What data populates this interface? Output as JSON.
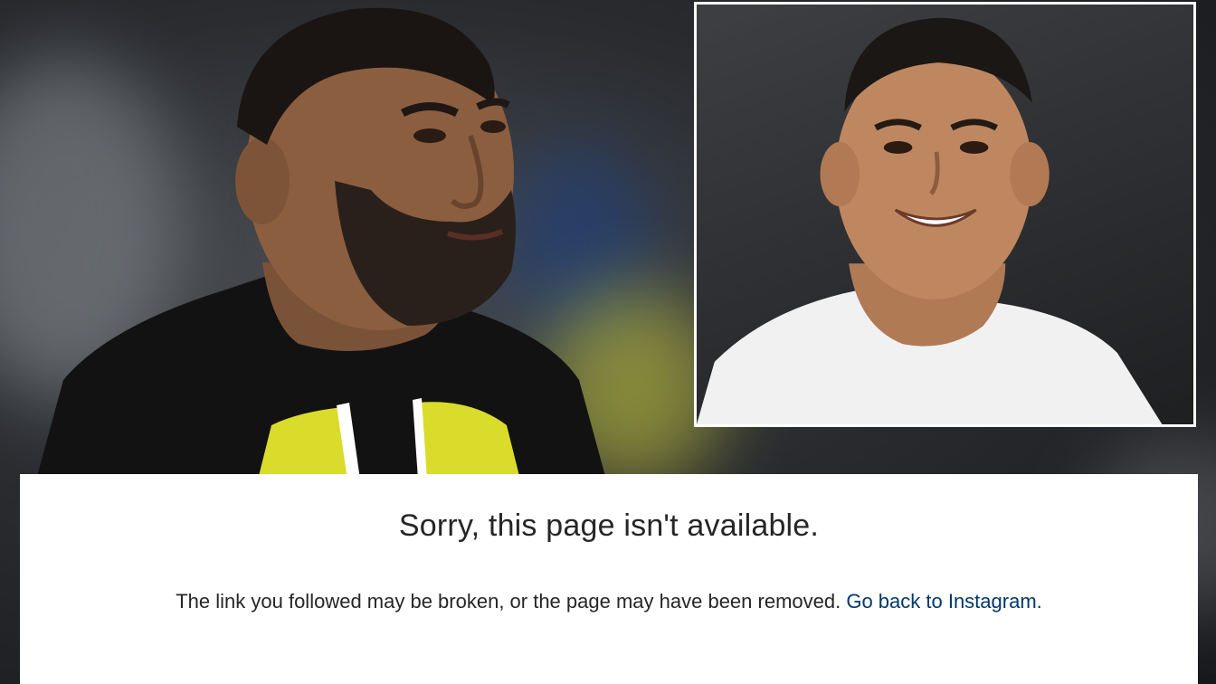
{
  "error": {
    "title": "Sorry, this page isn't available.",
    "message": "The link you followed may be broken, or the page may have been removed.",
    "link_label": "Go back to Instagram."
  },
  "colors": {
    "card_background": "#ffffff",
    "text": "#262626",
    "link": "#00376b",
    "kit_yellow": "#d9dc2a",
    "kit_black": "#121212",
    "inset_border": "#ffffff"
  },
  "images": {
    "main": "bearded-footballer-in-black-and-yellow-kit",
    "inset": "smiling-footballer-in-white-shirt"
  }
}
